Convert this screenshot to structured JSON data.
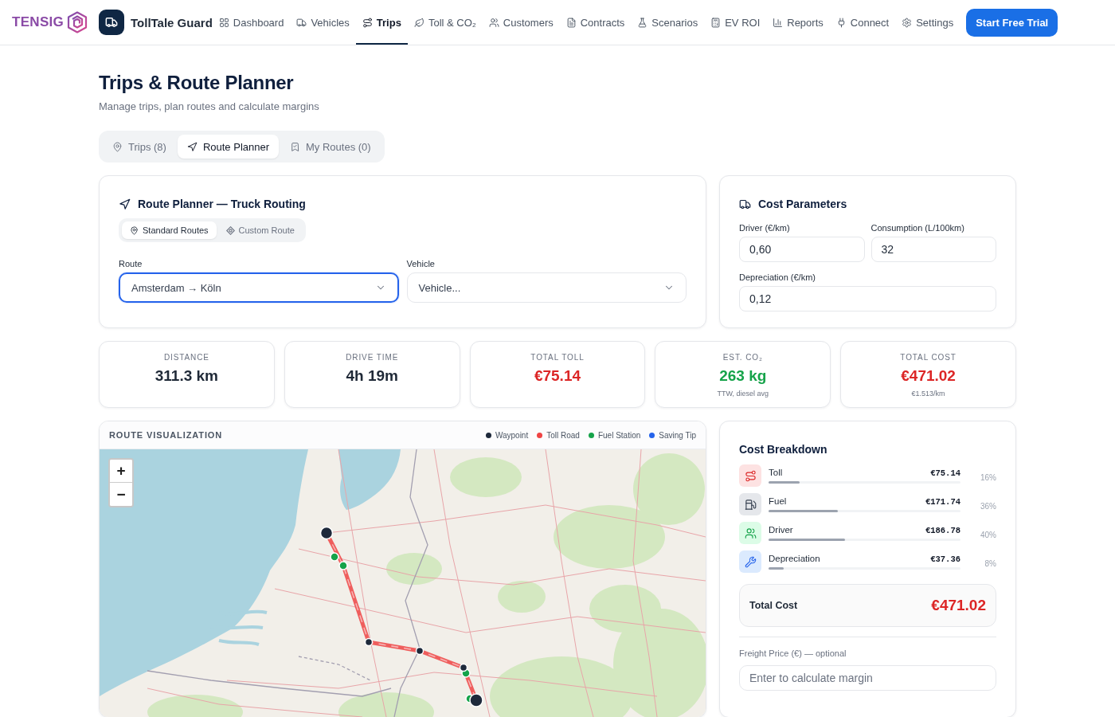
{
  "brand": {
    "logo_text": "TENSIG",
    "app_name": "TollTale Guard"
  },
  "nav": {
    "items": [
      {
        "label": "Dashboard",
        "selected": false
      },
      {
        "label": "Vehicles",
        "selected": false
      },
      {
        "label": "Trips",
        "selected": true
      },
      {
        "label": "Toll & CO₂",
        "selected": false
      },
      {
        "label": "Customers",
        "selected": false
      },
      {
        "label": "Contracts",
        "selected": false
      },
      {
        "label": "Scenarios",
        "selected": false
      },
      {
        "label": "EV ROI",
        "selected": false
      },
      {
        "label": "Reports",
        "selected": false
      },
      {
        "label": "Connect",
        "selected": false
      },
      {
        "label": "Settings",
        "selected": false
      }
    ],
    "cta": "Start Free Trial"
  },
  "page": {
    "title": "Trips & Route Planner",
    "subtitle": "Manage trips, plan routes and calculate margins"
  },
  "tabs": [
    {
      "label": "Trips (8)",
      "selected": false
    },
    {
      "label": "Route Planner",
      "selected": true
    },
    {
      "label": "My Routes (0)",
      "selected": false
    }
  ],
  "route_planner": {
    "title": "Route Planner — Truck Routing",
    "modes": [
      {
        "label": "Standard Routes",
        "selected": true
      },
      {
        "label": "Custom Route",
        "selected": false
      }
    ],
    "fields": [
      {
        "label": "Route",
        "value": "Amsterdam → Köln",
        "focused": true
      },
      {
        "label": "Vehicle",
        "placeholder": "Vehicle...",
        "focused": false
      }
    ]
  },
  "cost_parameters": {
    "title": "Cost Parameters",
    "fields": [
      {
        "label": "Driver (€/km)",
        "value": "0,60"
      },
      {
        "label": "Consumption (L/100km)",
        "value": "32"
      },
      {
        "label": "Depreciation (€/km)",
        "value": "0,12"
      }
    ]
  },
  "stats": [
    {
      "label": "DISTANCE",
      "value": "311.3 km",
      "color": "#1f2937"
    },
    {
      "label": "DRIVE TIME",
      "value": "4h 19m",
      "color": "#1f2937"
    },
    {
      "label": "TOTAL TOLL",
      "value": "€75.14",
      "color": "#dc2626"
    },
    {
      "label": "EST. CO₂",
      "value": "263 kg",
      "note": "TTW, diesel avg",
      "color": "#16a34a"
    },
    {
      "label": "TOTAL COST",
      "value": "€471.02",
      "note": "€1.513/km",
      "color": "#dc2626"
    }
  ],
  "route_visualization": {
    "title": "ROUTE VISUALIZATION",
    "legend": [
      {
        "label": "Waypoint",
        "color": "#1e293b"
      },
      {
        "label": "Toll Road",
        "color": "#ef4444"
      },
      {
        "label": "Fuel Station",
        "color": "#16a34a"
      },
      {
        "label": "Saving Tip",
        "color": "#2563eb"
      }
    ],
    "zoom_controls": [
      "+",
      "−"
    ]
  },
  "cost_breakdown": {
    "title": "Cost Breakdown",
    "items": [
      {
        "name": "Toll",
        "amount": "€75.14",
        "share": "16%",
        "level": 0.16
      },
      {
        "name": "Fuel",
        "amount": "€171.74",
        "share": "36%",
        "level": 0.36
      },
      {
        "name": "Driver",
        "amount": "€186.78",
        "share": "40%",
        "level": 0.4
      },
      {
        "name": "Depreciation",
        "amount": "€37.36",
        "share": "8%",
        "level": 0.08
      }
    ],
    "total_label": "Total Cost",
    "total_value": "€471.02",
    "freight_label": "Freight Price (€) — optional",
    "freight_placeholder": "Enter to calculate margin"
  }
}
